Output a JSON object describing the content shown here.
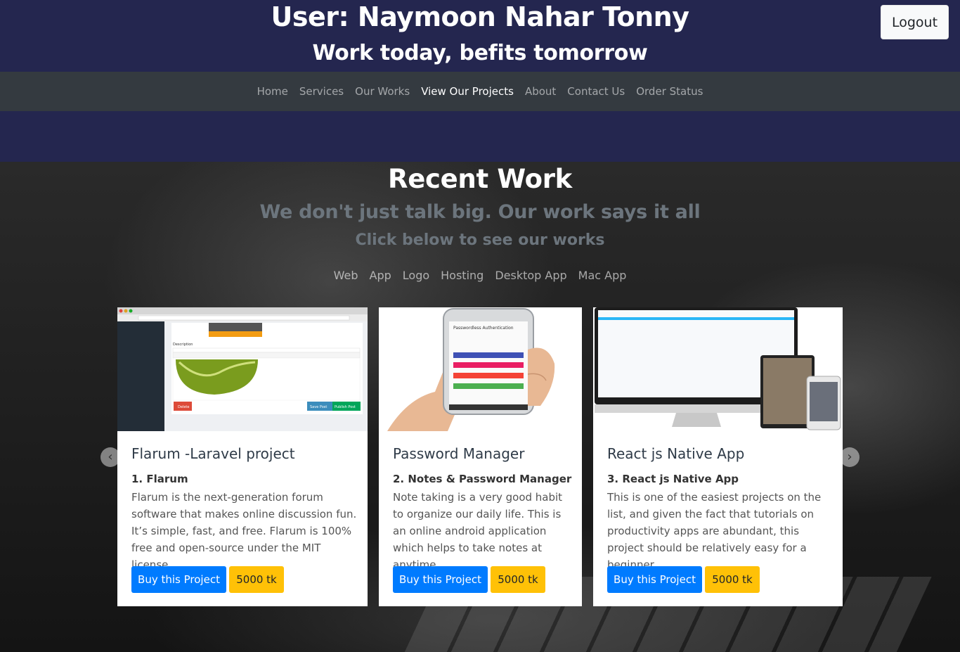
{
  "header": {
    "user_title": "User: Naymoon Nahar Tonny",
    "tagline": "Work today, befits tomorrow",
    "logout_label": "Logout"
  },
  "nav": {
    "items": [
      {
        "label": "Home",
        "active": false
      },
      {
        "label": "Services",
        "active": false
      },
      {
        "label": "Our Works",
        "active": false
      },
      {
        "label": "View Our Projects",
        "active": true
      },
      {
        "label": "About",
        "active": false
      },
      {
        "label": "Contact Us",
        "active": false
      },
      {
        "label": "Order Status",
        "active": false
      }
    ]
  },
  "recent": {
    "title": "Recent Work",
    "subtitle": "We don't just talk big. Our work says it all",
    "subtitle2": "Click below to see our works",
    "categories": [
      "Web",
      "App",
      "Logo",
      "Hosting",
      "Desktop App",
      "Mac App"
    ]
  },
  "carousel": {
    "prev_icon": "chevron-left-icon",
    "next_icon": "chevron-right-icon"
  },
  "cards": [
    {
      "title": "Flarum -Laravel project",
      "subtitle": "1. Flarum",
      "description": "Flarum is the next-generation forum software that makes online discussion fun. It’s simple, fast, and free. Flarum is 100% free and open-source under the MIT license",
      "buy_label": "Buy this Project",
      "price": "5000 tk",
      "image": {
        "description_icon": "laravel-editor-screenshot",
        "label": "Description",
        "delete": "Delete",
        "save": "Save Post",
        "publish": "Publish Post"
      }
    },
    {
      "title": "Password Manager",
      "subtitle": "2. Notes & Password Manager",
      "description": "Note taking is a very good habit to organize our daily life. This is an online android application which helps to take notes at anytime.",
      "buy_label": "Buy this Project",
      "price": "5000 tk",
      "image": {
        "icon": "phone-in-hand-image",
        "screen_title": "Passwordless Authentication"
      }
    },
    {
      "title": "React js Native App",
      "subtitle": "3. React js Native App",
      "description": "This is one of the easiest projects on the list, and given the fact that tutorials on productivity apps are abundant, this project should be relatively easy for a beginner.",
      "buy_label": "Buy this Project",
      "price": "5000 tk",
      "image": {
        "icon": "responsive-devices-image"
      }
    }
  ],
  "colors": {
    "header_bg": "#24264f",
    "navbar_bg": "#343a40",
    "primary": "#007bff",
    "warning": "#ffc107",
    "muted": "#6c757d"
  }
}
